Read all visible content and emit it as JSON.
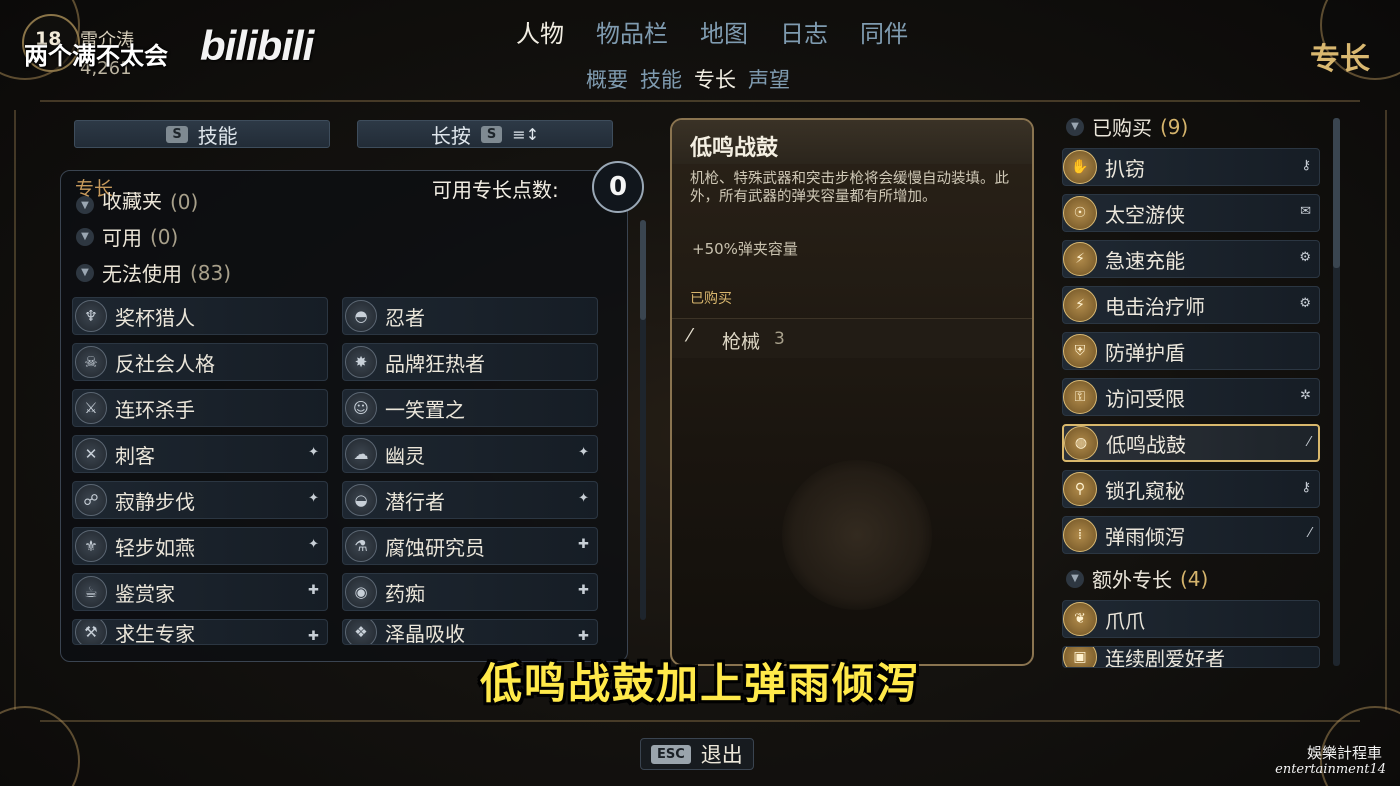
{
  "overlay": {
    "level": "18",
    "character_name": "雷介涛",
    "money": "4,261",
    "watermark_text": "两个满不太会",
    "logo_text": "bilibili"
  },
  "nav": {
    "main_tabs": [
      "人物",
      "物品栏",
      "地图",
      "日志",
      "同伴"
    ],
    "active_main": "人物",
    "sub_tabs": [
      "概要",
      "技能",
      "专长",
      "声望"
    ],
    "active_sub": "专长",
    "page_heading": "专长"
  },
  "toolbar": {
    "skills_key": "S",
    "skills_label": "技能",
    "hold_label": "长按",
    "hold_key": "S",
    "sort_glyph": "≡↕"
  },
  "left_panel": {
    "label": "专长",
    "points_label": "可用专长点数:",
    "points_value": "0",
    "categories": [
      {
        "label": "收藏夹",
        "count": "(0)"
      },
      {
        "label": "可用",
        "count": "(0)"
      },
      {
        "label": "无法使用",
        "count": "(83)"
      }
    ],
    "perks": [
      {
        "name": "奖杯猎人",
        "icon": "trophy-icon",
        "tag": ""
      },
      {
        "name": "忍者",
        "icon": "ninja-icon",
        "tag": ""
      },
      {
        "name": "反社会人格",
        "icon": "skull-icon",
        "tag": ""
      },
      {
        "name": "品牌狂热者",
        "icon": "star-icon",
        "tag": ""
      },
      {
        "name": "连环杀手",
        "icon": "knife-icon",
        "tag": ""
      },
      {
        "name": "一笑置之",
        "icon": "laugh-icon",
        "tag": ""
      },
      {
        "name": "刺客",
        "icon": "crossed-blades-icon",
        "tag": "stealth-icon"
      },
      {
        "name": "幽灵",
        "icon": "ghost-icon",
        "tag": "stealth-icon"
      },
      {
        "name": "寂静步伐",
        "icon": "footstep-icon",
        "tag": "stealth-icon"
      },
      {
        "name": "潜行者",
        "icon": "hood-icon",
        "tag": "stealth-icon"
      },
      {
        "name": "轻步如燕",
        "icon": "feather-icon",
        "tag": "stealth-icon"
      },
      {
        "name": "腐蚀研究员",
        "icon": "flask-icon",
        "tag": "medkit-icon"
      },
      {
        "name": "鉴赏家",
        "icon": "cup-icon",
        "tag": "medkit-icon"
      },
      {
        "name": "药痴",
        "icon": "pill-icon",
        "tag": "medkit-icon"
      },
      {
        "name": "求生专家",
        "icon": "tool-icon",
        "tag": "medkit-icon"
      },
      {
        "name": "泽晶吸收",
        "icon": "crystal-icon",
        "tag": "medkit-icon"
      }
    ]
  },
  "detail": {
    "title": "低鸣战鼓",
    "description": "机枪、特殊武器和突击步枪将会缓慢自动装填。此外，所有武器的弹夹容量都有所增加。",
    "bonus": "+50%弹夹容量",
    "purchased_label": "已购买",
    "requirement_label": "枪械",
    "requirement_level": "3"
  },
  "right_panel": {
    "purchased_header": "已购买",
    "purchased_count": "(9)",
    "purchased": [
      {
        "name": "扒窃",
        "icon": "hand-icon",
        "tag": "lockpick-tag-icon",
        "selected": false
      },
      {
        "name": "太空游侠",
        "icon": "astronaut-icon",
        "tag": "dialog-tag-icon",
        "selected": false
      },
      {
        "name": "急速充能",
        "icon": "charge-icon",
        "tag": "gear-tag-icon",
        "selected": false
      },
      {
        "name": "电击治疗师",
        "icon": "shock-icon",
        "tag": "gear-tag-icon",
        "selected": false
      },
      {
        "name": "防弹护盾",
        "icon": "shield-icon",
        "tag": "",
        "selected": false
      },
      {
        "name": "访问受限",
        "icon": "lock-icon",
        "tag": "bug-tag-icon",
        "selected": false
      },
      {
        "name": "低鸣战鼓",
        "icon": "drum-icon",
        "tag": "gun-tag-icon",
        "selected": true
      },
      {
        "name": "锁孔窥秘",
        "icon": "keyhole-icon",
        "tag": "lockpick-tag-icon",
        "selected": false
      },
      {
        "name": "弹雨倾泻",
        "icon": "bullets-icon",
        "tag": "gun-tag-icon",
        "selected": false
      }
    ],
    "extra_header": "额外专长",
    "extra_count": "(4)",
    "extra": [
      {
        "name": "爪爪",
        "icon": "paw-icon",
        "tag": ""
      },
      {
        "name": "连续剧爱好者",
        "icon": "tv-icon",
        "tag": ""
      }
    ]
  },
  "subtitle": "低鸣战鼓加上弹雨倾泻",
  "footer": {
    "exit_key": "ESC",
    "exit_label": "退出",
    "watermark_cn": "娛樂計程車",
    "watermark_en": "entertainment14"
  }
}
